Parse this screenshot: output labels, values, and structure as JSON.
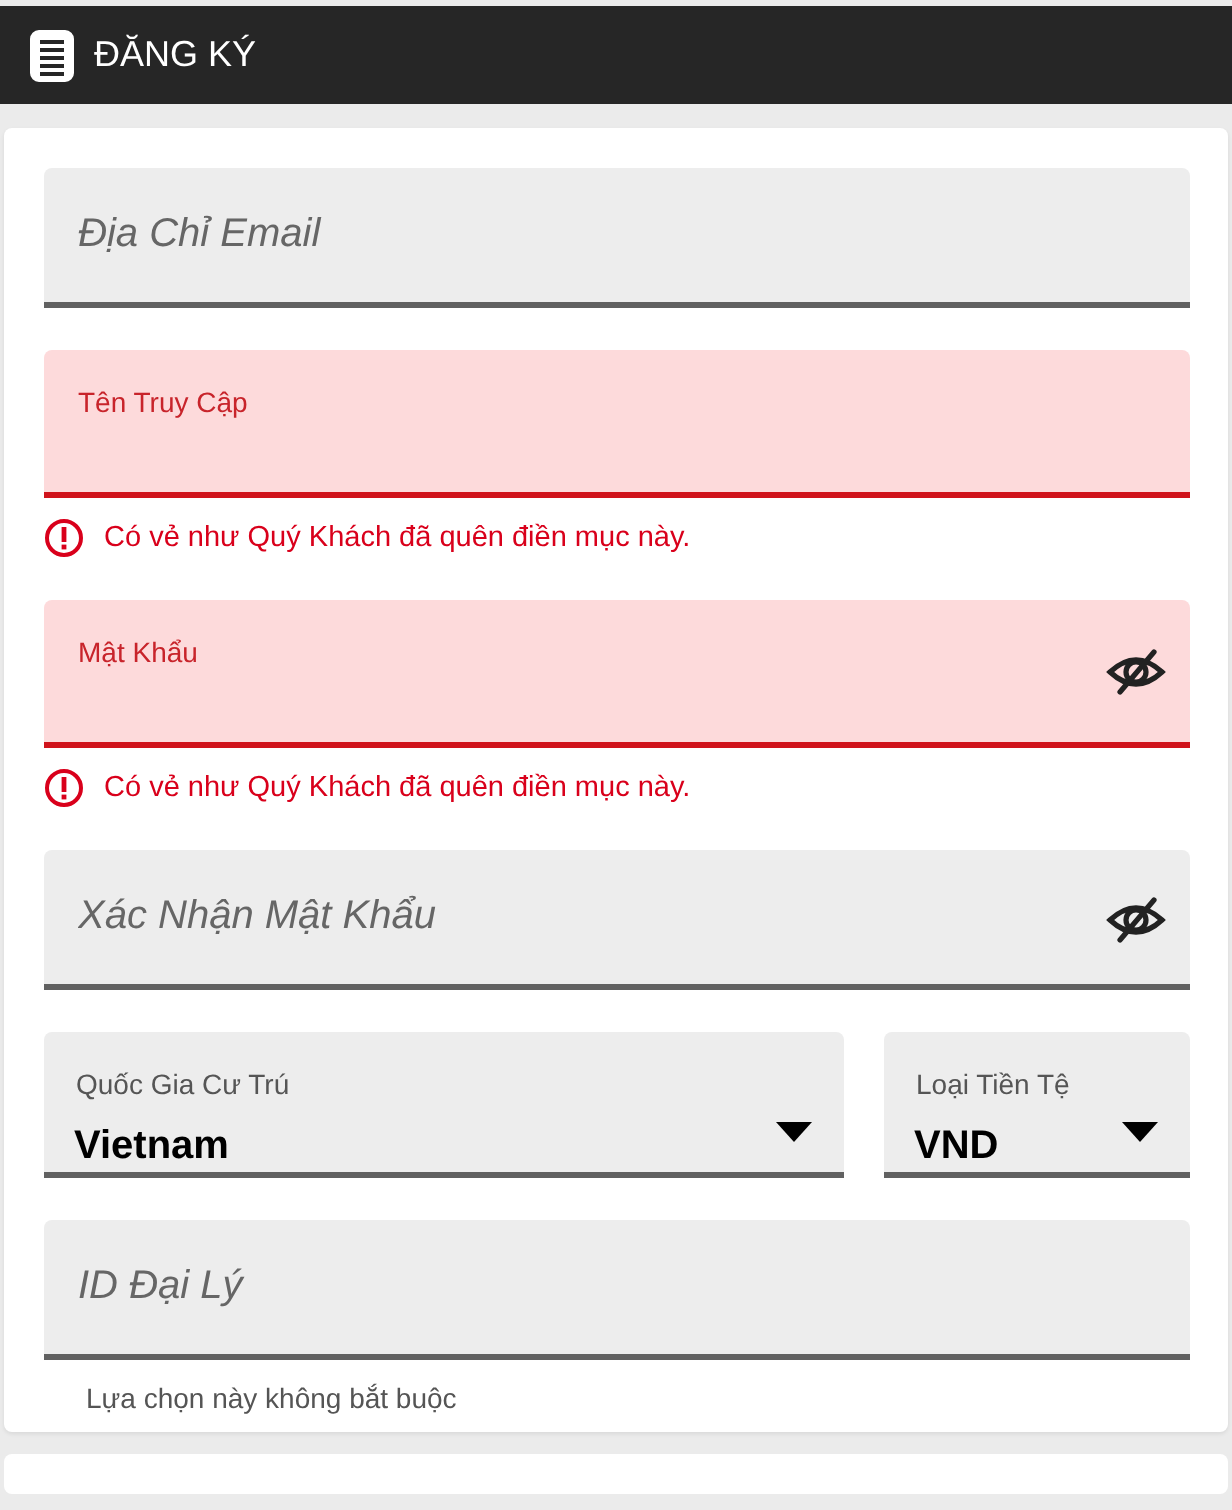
{
  "header": {
    "title": "ĐĂNG KÝ"
  },
  "form": [
    {
      "kind": "text",
      "placeholder": "Địa Chỉ Email",
      "invalid": false
    },
    {
      "kind": "text",
      "label": "Tên Truy Cập",
      "invalid": true,
      "error": "Có vẻ như Quý Khách đã quên điền mục này."
    },
    {
      "kind": "password",
      "label": "Mật Khẩu",
      "invalid": true,
      "error": "Có vẻ như Quý Khách đã quên điền mục này."
    },
    {
      "kind": "password",
      "placeholder": "Xác Nhận Mật Khẩu",
      "invalid": false
    },
    {
      "kind": "selects",
      "items": [
        {
          "label": "Quốc Gia Cư Trú",
          "value": "Vietnam"
        },
        {
          "label": "Loại Tiền Tệ",
          "value": "VND"
        }
      ]
    },
    {
      "kind": "text",
      "placeholder": "ID Đại Lý",
      "invalid": false,
      "hint": "Lựa chọn này không bắt buộc"
    }
  ]
}
